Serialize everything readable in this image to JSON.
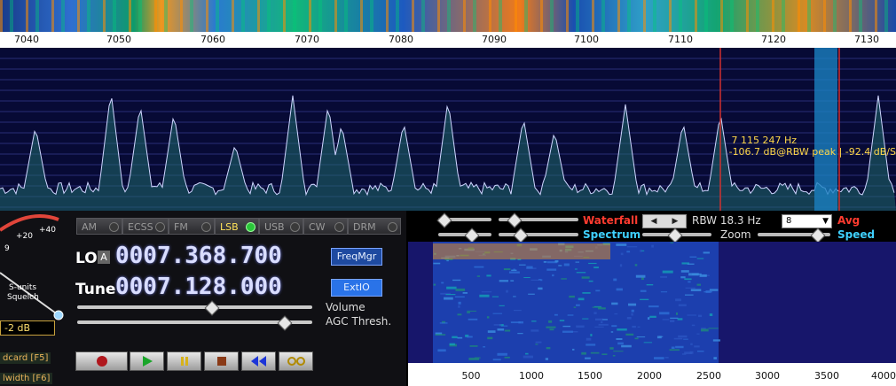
{
  "freq_axis": {
    "ticks": [
      "7040",
      "7050",
      "7060",
      "7070",
      "7080",
      "7090",
      "7100",
      "7110",
      "7120",
      "7130"
    ]
  },
  "spectrum": {
    "readout_freq": "7 115 247 Hz",
    "readout_level": "-106.7 dB@RBW peak | -92.4 dB/S"
  },
  "smeter": {
    "label_top1": "+20",
    "label_top2": "+40",
    "label_9": "9",
    "title1": "S-units",
    "title2": "Squelch",
    "squelch_value": "-2 dB"
  },
  "fkeys": {
    "soundcard": "dcard [F5]",
    "bandwidth": "lwidth [F6]"
  },
  "modes": [
    {
      "label": "AM",
      "active": false
    },
    {
      "label": "ECSS",
      "active": false
    },
    {
      "label": "FM",
      "active": false
    },
    {
      "label": "LSB",
      "active": true
    },
    {
      "label": "USB",
      "active": false
    },
    {
      "label": "CW",
      "active": false
    },
    {
      "label": "DRM",
      "active": false
    }
  ],
  "lo": {
    "label": "LO",
    "badge": "A",
    "value": "0007.368.700"
  },
  "tune": {
    "label": "Tune",
    "value": "0007.128.000"
  },
  "buttons": {
    "freqmgr": "FreqMgr",
    "extio": "ExtIO"
  },
  "sliders": {
    "volume_label": "Volume",
    "volume_level": 0.57,
    "agc_label": "AGC Thresh.",
    "agc_level": 0.88
  },
  "waterfall_ctl": {
    "waterfall_label": "Waterfall",
    "spectrum_label": "Spectrum",
    "rbw_label": "RBW 18.3 Hz",
    "zoom_label": "Zoom",
    "avg_select": "8",
    "avg_label": "Avg",
    "speed_label": "Speed",
    "colors": {
      "waterfall": "#ff3b2f",
      "spectrum": "#3fd0ff",
      "avg": "#ff3b2f",
      "speed": "#3fd0ff"
    }
  },
  "audio_axis": {
    "ticks": [
      "500",
      "1000",
      "1500",
      "2000",
      "2500",
      "3000",
      "3500",
      "4000"
    ]
  }
}
